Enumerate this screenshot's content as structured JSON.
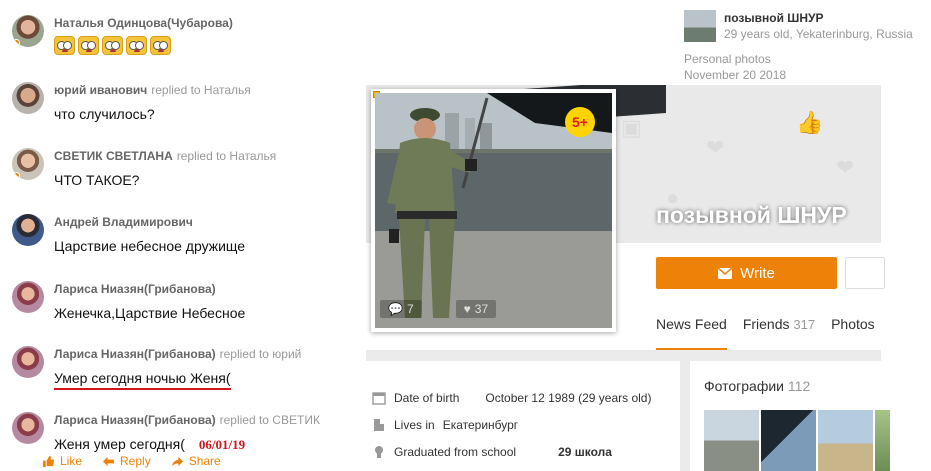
{
  "comments": [
    {
      "author": "Наталья Одинцова(Чубарова)",
      "reply_to": "",
      "text": "",
      "emoji_count": 5
    },
    {
      "author": "юрий иванович",
      "reply_to": "replied to Наталья",
      "text": "что случилось?"
    },
    {
      "author": "СВЕТИК СВЕТЛАНА",
      "reply_to": "replied to Наталья",
      "text": "ЧТО ТАКОЕ?"
    },
    {
      "author": "Андрей Владимирович",
      "reply_to": "",
      "text": "Царствие небесное дружище"
    },
    {
      "author": "Лариса Ниазян(Грибанова)",
      "reply_to": "",
      "text": "Женечка,Царствие Небесное"
    },
    {
      "author": "Лариса Ниазян(Грибанова)",
      "reply_to": "replied to юрий",
      "text": "Умер сегодня ночью Женя("
    },
    {
      "author": "Лариса Ниазян(Грибанова)",
      "reply_to": "replied to СВЕТИК",
      "text": "Женя умер сегодня(",
      "note": "06/01/19"
    }
  ],
  "actions": {
    "like": "Like",
    "reply": "Reply",
    "share": "Share"
  },
  "user_header": {
    "name": "позывной ШНУР",
    "meta": "29 years old, Yekaterinburg, Russia",
    "section": "Personal photos",
    "date": "November 20 2018"
  },
  "profile": {
    "name": "позывной ШНУР",
    "age_badge": "5+",
    "photo_comments": "7",
    "photo_likes": "37",
    "write_button": "Write",
    "tabs": [
      {
        "label": "News Feed",
        "count": ""
      },
      {
        "label": "Friends",
        "count": "317"
      },
      {
        "label": "Photos",
        "count": ""
      }
    ],
    "info": [
      {
        "label": "Date of birth",
        "value": "October 12 1989 (29 years old)"
      },
      {
        "label": "Lives in",
        "value": "Екатеринбург"
      },
      {
        "label": "Graduated from school",
        "value": "29 школа"
      }
    ],
    "photos_title": "Фотографии",
    "photos_count": "112"
  },
  "colors": {
    "accent": "#ee8208",
    "annotation_red": "#d0161b"
  }
}
